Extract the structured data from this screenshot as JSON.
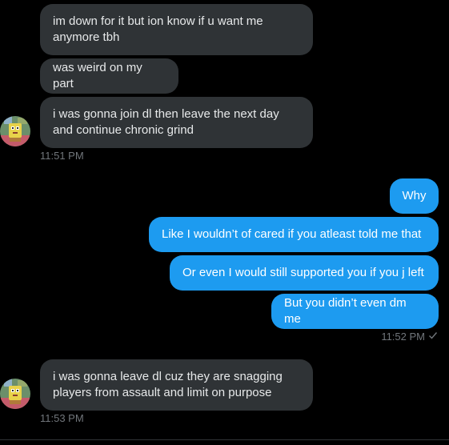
{
  "conversation": {
    "group1": {
      "messages": [
        "im down for it but ion know if u want me anymore tbh",
        "was weird on my part",
        "i was gonna join dl then leave the next day and continue chronic grind"
      ],
      "timestamp": "11:51 PM"
    },
    "group2": {
      "messages": [
        "Why",
        "Like I wouldn’t of cared if you atleast told me that",
        "Or even I would still supported you if you j left",
        "But you didn’t even dm me"
      ],
      "timestamp": "11:52 PM",
      "status_icon": "checkmark-icon"
    },
    "group3": {
      "messages": [
        "i was gonna leave dl cuz they are snagging players from assault and limit on purpose"
      ],
      "timestamp": "11:53 PM"
    }
  },
  "colors": {
    "background": "#000000",
    "incoming_bubble": "#2f3336",
    "outgoing_bubble": "#1d9bf0",
    "timestamp": "#71767b"
  }
}
